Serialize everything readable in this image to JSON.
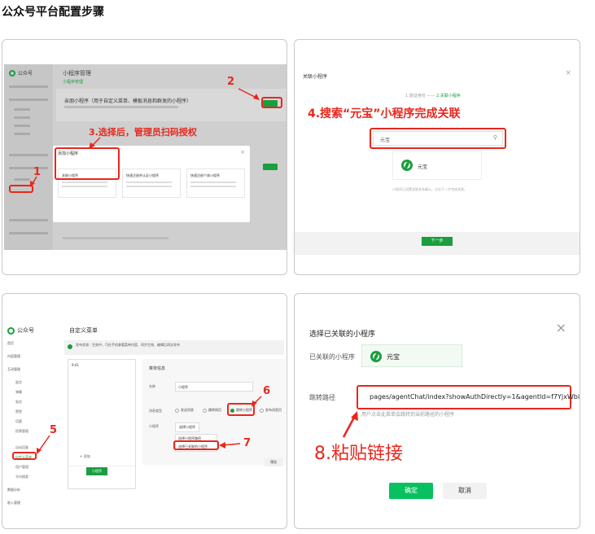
{
  "page_title": "公众号平台配置步骤",
  "colors": {
    "accent_green": "#1a9e3f",
    "annotation_red": "#e8271d",
    "wechat_green": "#07c160"
  },
  "card1": {
    "brand": "公众号",
    "page_title": "小程序管理",
    "tab": "小程序管理",
    "panel_title": "亲朋小程序（用于自定义菜单、模板消息和群发的小程序）",
    "dialog_title": "添加小程序",
    "dialog_close": "×",
    "options": [
      "关联小程序",
      "快速注册并认证小程序",
      "快速注册个体小程序"
    ],
    "sidebar_active": "小程序管理",
    "annotations": {
      "step1": "1",
      "step2": "2",
      "step3": "3.选择后，管理员扫码授权"
    }
  },
  "card2": {
    "title": "关联小程序",
    "close": "×",
    "step1": "1.验证身份",
    "step_sep": "——",
    "step2": "2.关联小程序",
    "search_value": "元宝",
    "search_icon": "search-icon",
    "result_name": "元宝",
    "hint": "小程序已设置关联关系确认，点击下一步完成关联。",
    "next_button": "下一步",
    "annotation": "4.搜索“元宝”小程序完成关联"
  },
  "card3": {
    "brand": "公众号",
    "page_title": "自定义菜单",
    "banner": "发布状态：生效中，可在手机查看菜单内容、同步生效、编辑后再次发布",
    "nav": [
      "首页",
      "内容管理",
      "互动管理"
    ],
    "sub_items": [
      "留言",
      "弹幕",
      "私信",
      "赞赏",
      "话题",
      "投票管理"
    ],
    "sub_items2": [
      "自动回复",
      "自定义菜单",
      "用户管理",
      "号内搜索"
    ],
    "active_item": "自定义菜单",
    "nav_bottom": [
      "数据分析",
      "收入管理"
    ],
    "phone_time": "9:41",
    "phone_add": "+ 添加",
    "phone_menu_button": "小程序",
    "panel_title": "菜单信息",
    "name_label": "名称",
    "name_value": "小程序",
    "content_label": "消息类型",
    "radios": [
      "发送消息",
      "跳转网页",
      "跳转小程序",
      "发布消息页"
    ],
    "mini_label": "小程序",
    "mini_button": "选择小程序",
    "menu_items": [
      "选择小程序路径",
      "选择已关联的小程序"
    ],
    "save": "预览",
    "annotations": {
      "step5": "5",
      "step6": "6",
      "step7": "7"
    }
  },
  "card4": {
    "title": "选择已关联的小程序",
    "close": "×",
    "linked_label": "已关联的小程序",
    "app_name": "元宝",
    "path_label": "跳转路径",
    "path_value": "pages/agentChat/index?showAuthDirectly=1&agentId=f7YjxWbi",
    "help": "用户点击此菜单会跳转到当前路径的小程序",
    "confirm": "确定",
    "cancel": "取消",
    "annotation": "8.粘贴链接"
  }
}
